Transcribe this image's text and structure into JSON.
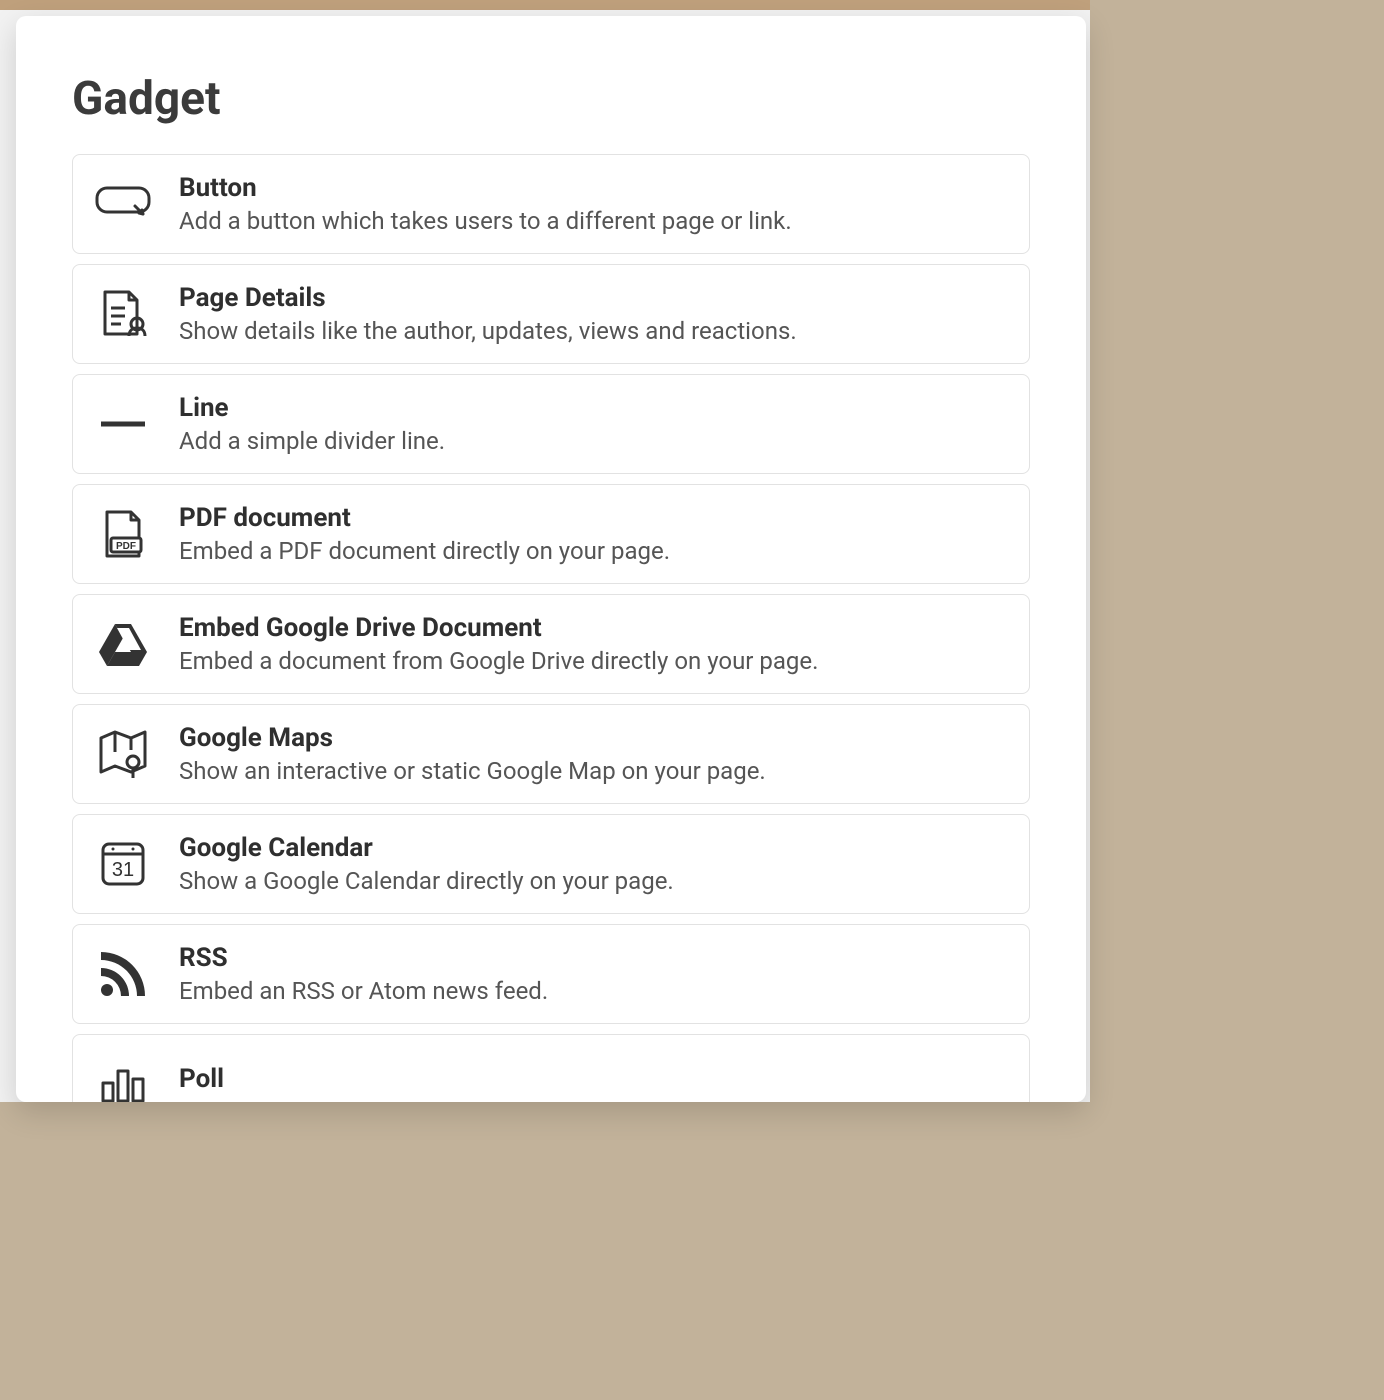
{
  "modal": {
    "title": "Gadget",
    "items": [
      {
        "id": "button",
        "title": "Button",
        "desc": "Add a button which takes users to a different page or link."
      },
      {
        "id": "page-details",
        "title": "Page Details",
        "desc": "Show details like the author, updates, views and reactions."
      },
      {
        "id": "line",
        "title": "Line",
        "desc": "Add a simple divider line."
      },
      {
        "id": "pdf",
        "title": "PDF document",
        "desc": "Embed a PDF document directly on your page."
      },
      {
        "id": "gdrive",
        "title": "Embed Google Drive Document",
        "desc": "Embed a document from Google Drive directly on your page."
      },
      {
        "id": "gmaps",
        "title": "Google Maps",
        "desc": "Show an interactive or static Google Map on your page."
      },
      {
        "id": "gcal",
        "title": "Google Calendar",
        "desc": "Show a Google Calendar directly on your page."
      },
      {
        "id": "rss",
        "title": "RSS",
        "desc": "Embed an RSS or Atom news feed."
      },
      {
        "id": "poll",
        "title": "Poll",
        "desc": ""
      }
    ]
  }
}
